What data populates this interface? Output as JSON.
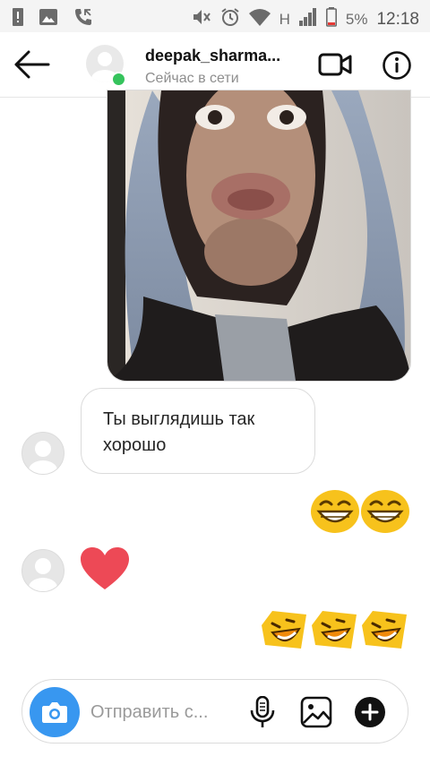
{
  "status_bar": {
    "battery": "5%",
    "network": "H",
    "time": "12:18",
    "icons": [
      "alert-icon",
      "image-notification-icon",
      "missed-call-icon",
      "mute-icon",
      "alarm-icon",
      "wifi-icon",
      "signal-icon",
      "battery-low-icon"
    ]
  },
  "header": {
    "username": "deepak_sharma...",
    "status": "Сейчас в сети",
    "online": true,
    "icons": [
      "back-arrow-icon",
      "video-call-icon",
      "info-icon"
    ]
  },
  "messages": [
    {
      "type": "photo",
      "from": "me",
      "image": "selfie-photo"
    },
    {
      "type": "text",
      "from": "them",
      "text": "Ты выглядишь так хорошо"
    },
    {
      "type": "emoji",
      "from": "me",
      "emoji": [
        "grinning-squint-emoji",
        "grinning-squint-emoji"
      ]
    },
    {
      "type": "emoji",
      "from": "them",
      "emoji": [
        "red-heart-emoji"
      ]
    },
    {
      "type": "emoji",
      "from": "me",
      "emoji": [
        "laughing-tilted-emoji",
        "laughing-tilted-emoji",
        "laughing-tilted-emoji"
      ]
    }
  ],
  "composer": {
    "placeholder": "Отправить с...",
    "icons": [
      "camera-icon",
      "microphone-icon",
      "gallery-icon",
      "add-icon"
    ]
  },
  "colors": {
    "accent_blue": "#3897f0",
    "online_green": "#35c35c",
    "heart_red": "#ed4956",
    "emoji_yellow": "#f7c21c",
    "emoji_orange": "#f08a0a"
  }
}
